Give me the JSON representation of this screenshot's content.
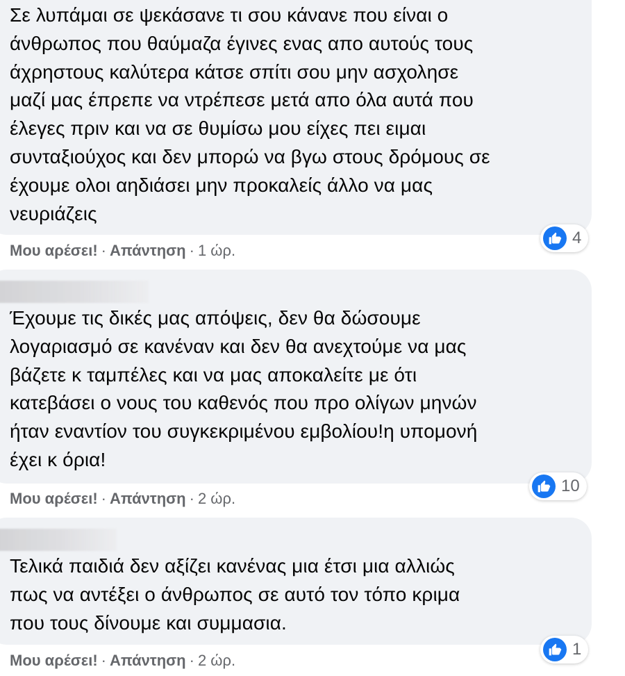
{
  "comments": [
    {
      "author": "",
      "text": "Σε λυπάμαι σε ψεκάσανε τι σου κάνανε που είναι ο\nάνθρωπος που θαύμαζα έγινες ενας απο αυτούς τους\nάχρηστους καλύτερα κάτσε σπίτι σου μην ασχολησε\nμαζί μας έπρεπε να ντρέπεσε μετά απο όλα αυτά που\nέλεγες πριν και να σε θυμίσω μου είχες πει ειμαι\nσυνταξιούχος και δεν μπορώ να βγω στους δρόμους σε\nέχουμε ολοι αηδιάσει μην προκαλείς άλλο να μας\nνευριάζεις",
      "reaction_count": "4",
      "like_label": "Μου αρέσει!",
      "reply_label": "Απάντηση",
      "timestamp": "1 ώρ."
    },
    {
      "author": "",
      "text": "Έχουμε τις δικές μας απόψεις, δεν θα δώσουμε\nλογαριασμό σε κανέναν και δεν θα ανεχτούμε να μας\nβάζετε κ ταμπέλες και να μας αποκαλείτε με ότι\nκατεβάσει ο νους του καθενός που προ ολίγων μηνών\nήταν εναντίον του συγκεκριμένου εμβολίου!η υπομονή\nέχει κ όρια!",
      "reaction_count": "10",
      "like_label": "Μου αρέσει!",
      "reply_label": "Απάντηση",
      "timestamp": "2 ώρ."
    },
    {
      "author": "",
      "text": "Τελικά παιδιά δεν αξίζει κανένας μια έτσι μια αλλιώς\nπως να αντέξει ο άνθρωπος σε αυτό τον τόπο κριμα\nπου τους δίνουμε και συμμασια.",
      "reaction_count": "1",
      "like_label": "Μου αρέσει!",
      "reply_label": "Απάντηση",
      "timestamp": "2 ώρ."
    }
  ],
  "separator": "·",
  "reaction_icon": "like-thumb-icon",
  "colors": {
    "bubble": "#f0f2f5",
    "like_blue": "#1877f2",
    "meta_text": "#65676b",
    "text": "#050505"
  }
}
